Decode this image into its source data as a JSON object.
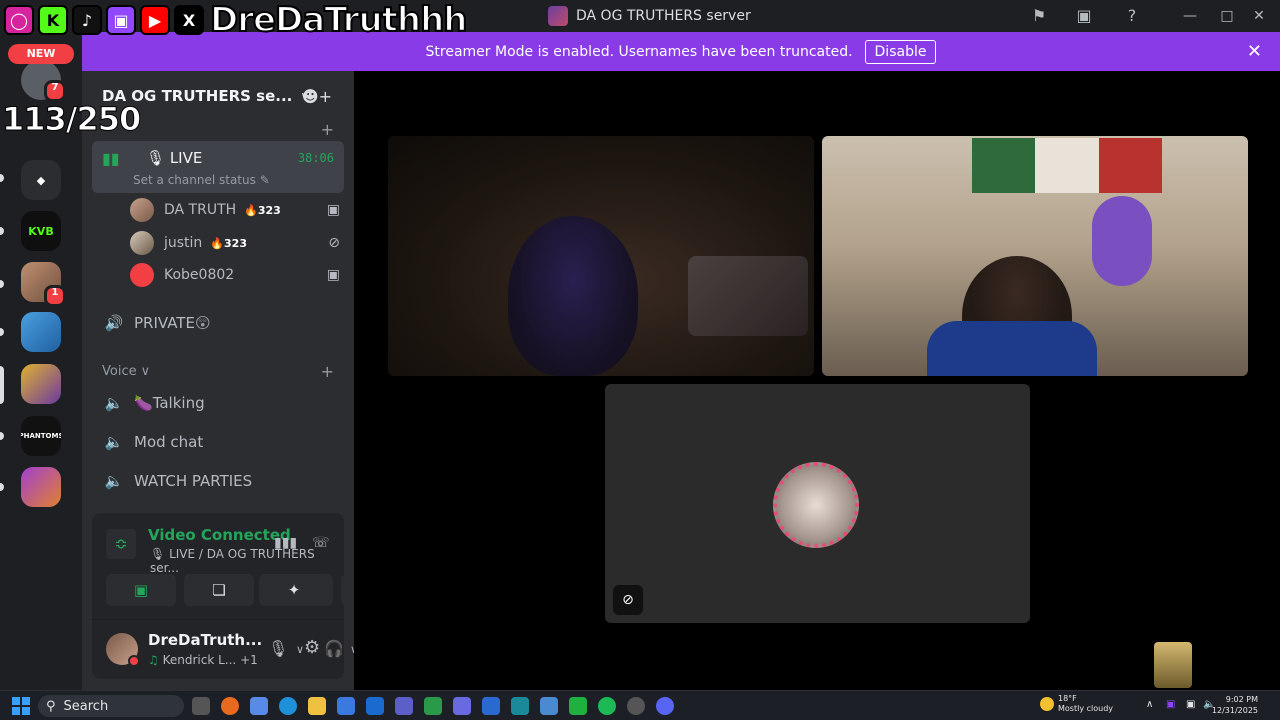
{
  "overlay": {
    "handle": "DreDaTruthhh",
    "social_icons": [
      "instagram-icon",
      "kick-icon",
      "tiktok-icon",
      "twitch-icon",
      "youtube-icon",
      "x-icon"
    ],
    "counter": "113/250"
  },
  "window": {
    "title": "DA OG TRUTHERS server"
  },
  "banner": {
    "text": "Streamer Mode is enabled. Usernames have been truncated.",
    "button": "Disable"
  },
  "rail": {
    "new_label": "NEW",
    "badges": [
      "7",
      "1"
    ],
    "kvb_label": "KVB",
    "phantoms_label": "PHANTOMS"
  },
  "server": {
    "name": "DA OG TRUTHERS se..."
  },
  "channels": {
    "live": {
      "name": "LIVE",
      "timer": "38:06",
      "status": "Set a channel status"
    },
    "voice_users": [
      {
        "name": "DA TRUTH",
        "count": "323",
        "state_icon": "camera-icon"
      },
      {
        "name": "justin",
        "count": "323",
        "state_icon": "mic-off-icon"
      },
      {
        "name": "Kobe0802",
        "count": "",
        "state_icon": "camera-icon"
      }
    ],
    "private": "PRIVATE",
    "category": "Voice",
    "voice_channels": [
      "Talking",
      "Mod chat",
      "WATCH PARTIES"
    ]
  },
  "voice_panel": {
    "title": "Video Connected",
    "subtitle": "LIVE / DA OG TRUTHERS ser...",
    "user_name": "DreDaTruth...",
    "user_activity": "Kendrick L...",
    "activity_extra": "+1"
  },
  "taskbar": {
    "search": "Search",
    "temp": "18°F",
    "weather": "Mostly cloudy",
    "time": "9:02 PM",
    "date": "12/31/2025"
  },
  "colors": {
    "accent_banner": "#8a3be8",
    "connected_green": "#23a55a",
    "badge_red": "#f23f43"
  }
}
